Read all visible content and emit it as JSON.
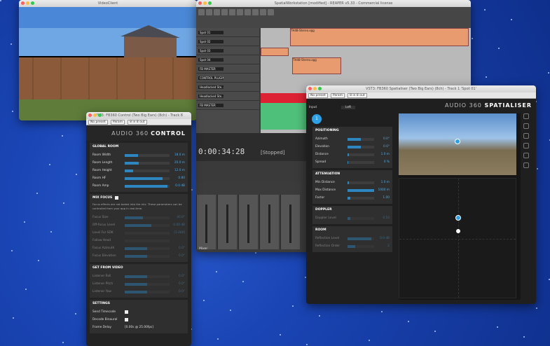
{
  "control": {
    "plugin_bar": {
      "preset": "No preset",
      "param": "Param",
      "io": "8 in 8 out",
      "title": "VST3: FB360 Control (Two Big Ears) (8ch) - Track 8"
    },
    "brand_a": "AUDIO 360",
    "brand_b": "CONTROL",
    "global_room": {
      "title": "GLOBAL ROOM",
      "rows": [
        {
          "label": "Room Width",
          "value": "18.0 m",
          "pct": 30
        },
        {
          "label": "Room Length",
          "value": "20.0 m",
          "pct": 32
        },
        {
          "label": "Room Height",
          "value": "12.0 m",
          "pct": 18
        },
        {
          "label": "Room HF",
          "value": "0.80",
          "pct": 85
        },
        {
          "label": "Room Amp",
          "value": "0.0 dB",
          "pct": 96
        }
      ]
    },
    "mix_focus": {
      "title": "MIX FOCUS",
      "note": "Focus effects are not baked into the mix. These parameters can be controlled from your app in real-time.",
      "rows": [
        {
          "label": "Focus Size",
          "value": "40.0°",
          "pct": 40
        },
        {
          "label": "Off-focus Level",
          "value": "0.00 dB",
          "pct": 60
        },
        {
          "label": "Level For SDK",
          "value": "[1.000]",
          "pct": 0
        },
        {
          "label": "Follow Head",
          "value": "",
          "pct": 0
        },
        {
          "label": "Focus Azimuth",
          "value": "0.0°",
          "pct": 50
        },
        {
          "label": "Focus Elevation",
          "value": "0.0°",
          "pct": 50
        }
      ]
    },
    "from_video": {
      "title": "GET FROM VIDEO",
      "rows": [
        {
          "label": "Listener Roll",
          "value": "0.0°",
          "pct": 50
        },
        {
          "label": "Listener Pitch",
          "value": "0.0°",
          "pct": 50
        },
        {
          "label": "Listener Yaw",
          "value": "0.0°",
          "pct": 50
        }
      ]
    },
    "settings": {
      "title": "SETTINGS",
      "rows": [
        {
          "label": "Send Timecode"
        },
        {
          "label": "Decode Binaural"
        },
        {
          "label": "Frame Delay",
          "value": "[0.00s @ 25.00fps]"
        }
      ]
    }
  },
  "video": {
    "title": "VideoClient"
  },
  "reaper": {
    "title": "SpatialWorkstation [modified] - REAPER v5.33 - Commercial license",
    "tracks": [
      "Spot 01",
      "Spot 02",
      "Spot 03",
      "Spot 04",
      "FB MASTER",
      "CONTROL PLUGIN",
      "Headlocked Ste...",
      "Headlocked Ste...",
      "FB MASTER"
    ],
    "clips": [
      "TH48-Stereo.ogg",
      "TH48-Stereo.ogg"
    ],
    "time": "0:00:34:28",
    "state": "[Stopped]",
    "mixer_label": "Mixer"
  },
  "spat": {
    "plugin_bar": {
      "preset": "No preset",
      "param": "Param",
      "io": "8 in 8 out",
      "title": "VST3: FB360 Spatialiser (Two Big Ears) (8ch) - Track 1 'Spot 01'"
    },
    "brand_a": "AUDIO 360",
    "brand_b": "SPATIALISER",
    "input_label": "Input",
    "input_value": "Left",
    "source_num": "1",
    "positioning": {
      "title": "POSITIONING",
      "rows": [
        {
          "label": "Azimuth",
          "value": "0.0°",
          "pct": 50
        },
        {
          "label": "Elevation",
          "value": "0.0°",
          "pct": 50
        },
        {
          "label": "Distance",
          "value": "1.0 m",
          "pct": 4
        },
        {
          "label": "Spread",
          "value": "0 %",
          "pct": 2
        }
      ]
    },
    "attenuation": {
      "title": "ATTENUATION",
      "rows": [
        {
          "label": "Min Distance",
          "value": "1.0 m",
          "pct": 4
        },
        {
          "label": "Max Distance",
          "value": "1000 m",
          "pct": 100
        },
        {
          "label": "Factor",
          "value": "1.00",
          "pct": 10
        }
      ]
    },
    "doppler": {
      "title": "DOPPLER",
      "rows": [
        {
          "label": "Doppler Level",
          "value": "0.10",
          "pct": 10
        }
      ]
    },
    "room": {
      "title": "ROOM",
      "rows": [
        {
          "label": "Reflection Level",
          "value": "0.0 dB",
          "pct": 90
        },
        {
          "label": "Reflection Order",
          "value": "2",
          "pct": 30
        }
      ]
    }
  }
}
